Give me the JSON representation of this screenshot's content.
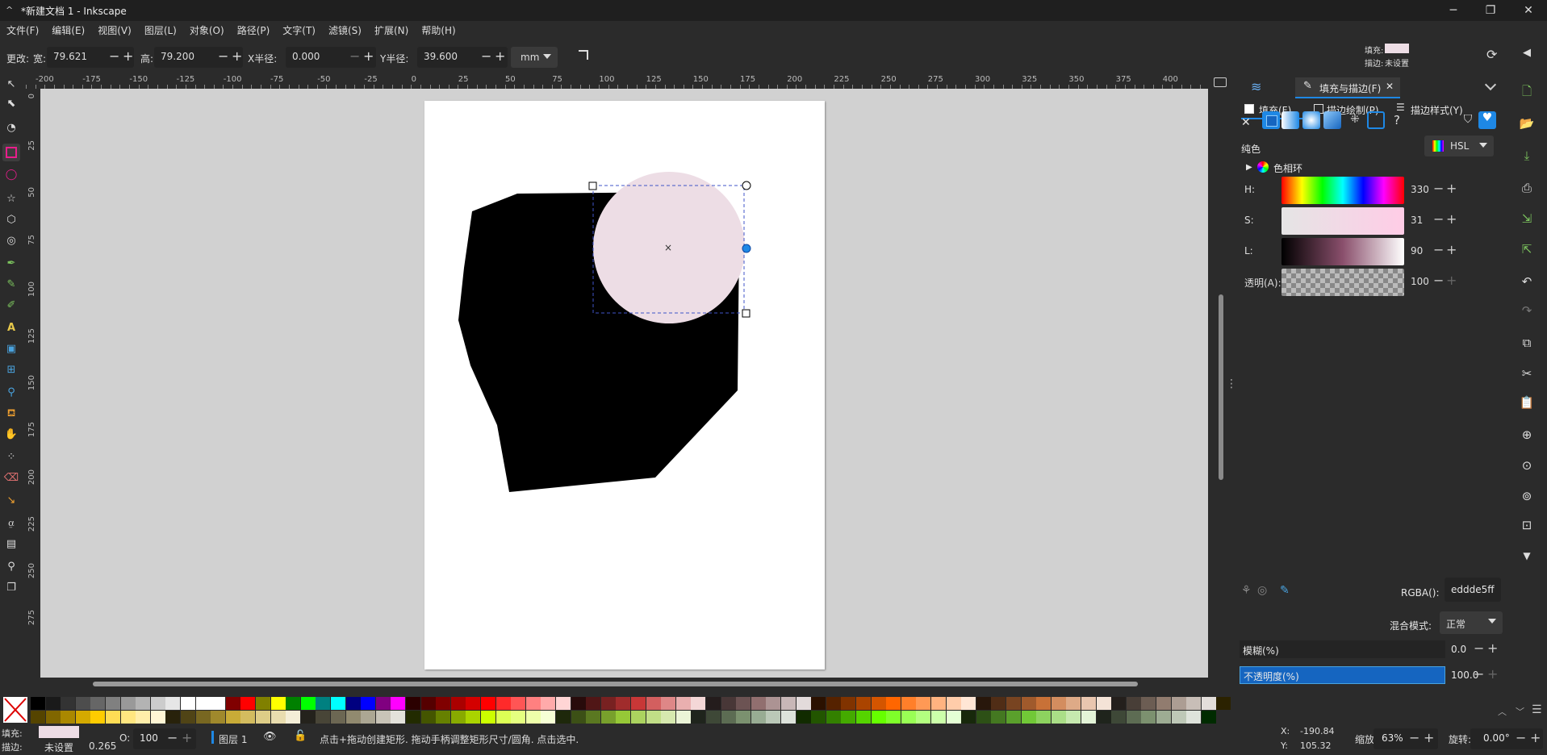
{
  "window": {
    "title": "*新建文档 1 - Inkscape",
    "minimize": "─",
    "maximize": "❐",
    "close": "✕"
  },
  "menu": [
    "文件(F)",
    "编辑(E)",
    "视图(V)",
    "图层(L)",
    "对象(O)",
    "路径(P)",
    "文字(T)",
    "滤镜(S)",
    "扩展(N)",
    "帮助(H)"
  ],
  "toolcontrols": {
    "change_label": "更改:",
    "width_label": "宽:",
    "width_value": "79.621",
    "height_label": "高:",
    "height_value": "79.200",
    "rx_label": "X半径:",
    "rx_value": "0.000",
    "ry_label": "Y半径:",
    "ry_value": "39.600",
    "unit": "mm",
    "fill_label": "填充:",
    "stroke_label": "描边:",
    "stroke_value": "未设置"
  },
  "ruler": {
    "h_labels": [
      "-200",
      "-175",
      "-150",
      "-125",
      "-100",
      "-75",
      "-50",
      "-25",
      "0",
      "25",
      "50",
      "75",
      "100",
      "125",
      "150",
      "175",
      "200",
      "225",
      "250",
      "275",
      "300",
      "325",
      "350",
      "375",
      "400"
    ],
    "v_labels": [
      "0",
      "25",
      "50",
      "75",
      "100",
      "125",
      "150",
      "175",
      "200",
      "225",
      "250",
      "275"
    ]
  },
  "dialog": {
    "tab_title": "填充与描边(F)",
    "subtabs": [
      "填充(F)",
      "描边绘制(P)",
      "描边样式(Y)"
    ],
    "flat_label": "纯色",
    "mode": "HSL",
    "wheel_label": "色相环",
    "sliders": [
      {
        "label": "H:",
        "value": "330"
      },
      {
        "label": "S:",
        "value": "31"
      },
      {
        "label": "L:",
        "value": "90"
      },
      {
        "label": "透明(A):",
        "value": "100"
      }
    ],
    "rgba_label": "RGBA():",
    "rgba_value": "eddde5ff",
    "blend_label": "混合模式:",
    "blend_value": "正常",
    "blur_label": "模糊(%)",
    "blur_value": "0.0",
    "opacity_label": "不透明度(%)",
    "opacity_value": "100.0"
  },
  "status": {
    "fill_label": "填充:",
    "stroke_label": "描边:",
    "stroke_value": "未设置",
    "stroke_width": "0.265",
    "opacity_label": "O:",
    "opacity_value": "100",
    "layer": "图层 1",
    "message": "点击+拖动创建矩形. 拖动手柄调整矩形尺寸/圆角. 点击选中.",
    "x_label": "X:",
    "x_value": "-190.84",
    "y_label": "Y:",
    "y_value": "105.32",
    "zoom_label": "缩放:",
    "zoom_value": "63%",
    "rotate_label": "旋转:",
    "rotate_value": "0.00°"
  },
  "colors": {
    "fill_current": "#eddde5",
    "accent": "#1e88e5"
  }
}
